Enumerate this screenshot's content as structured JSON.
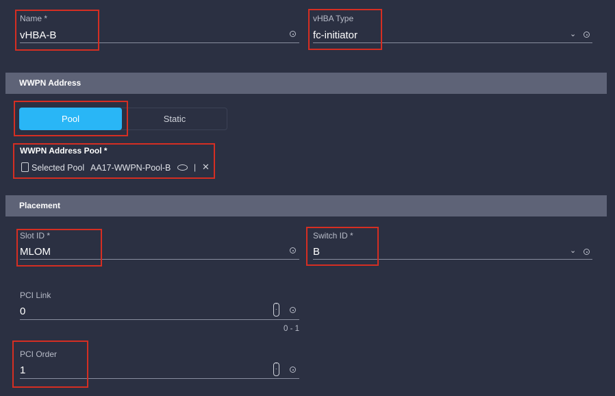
{
  "fields": {
    "name": {
      "label": "Name *",
      "value": "vHBA-B"
    },
    "vhba_type": {
      "label": "vHBA Type",
      "value": "fc-initiator"
    },
    "slot_id": {
      "label": "Slot ID *",
      "value": "MLOM"
    },
    "switch_id": {
      "label": "Switch ID *",
      "value": "B"
    },
    "pci_link": {
      "label": "PCI Link",
      "value": "0",
      "range": "0 - 1"
    },
    "pci_order": {
      "label": "PCI Order",
      "value": "1"
    }
  },
  "sections": {
    "wwpn": "WWPN Address",
    "placement": "Placement"
  },
  "wwpn": {
    "toggle": {
      "pool": "Pool",
      "static": "Static",
      "selected": "Pool"
    },
    "pool_label": "WWPN Address Pool *",
    "selected_pool_label": "Selected Pool",
    "selected_pool_value": "AA17-WWPN-Pool-B",
    "separator": "|"
  },
  "icons": {
    "info": "info-icon",
    "chevron": "chevron-down-icon",
    "eye": "eye-icon",
    "close": "close-icon",
    "doc": "document-icon",
    "stepper": "stepper-icon"
  },
  "colors": {
    "background": "#2b3042",
    "section_header": "#5e6377",
    "accent": "#29b6f6",
    "highlight_box": "#d62e22"
  }
}
